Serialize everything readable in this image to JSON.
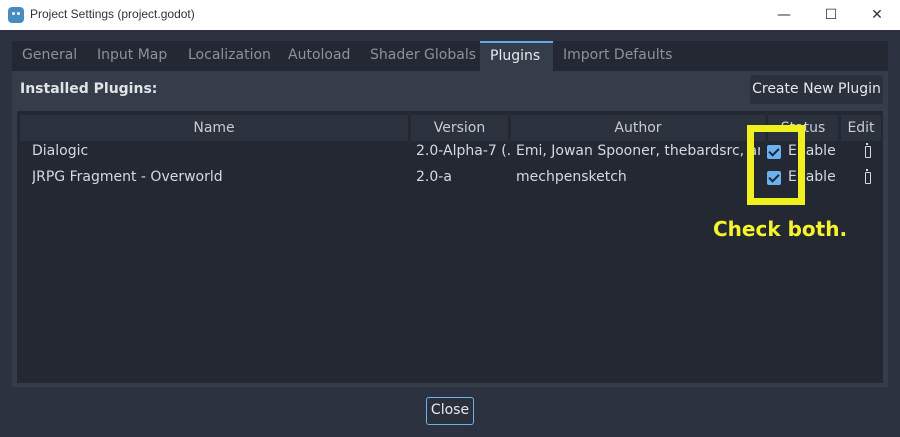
{
  "window": {
    "title": "Project Settings (project.godot)",
    "controls": {
      "minimize": "—",
      "maximize": "☐",
      "close": "✕"
    }
  },
  "tabs": [
    "General",
    "Input Map",
    "Localization",
    "Autoload",
    "Shader Globals",
    "Plugins",
    "Import Defaults"
  ],
  "active_tab": "Plugins",
  "plugins": {
    "installed_label": "Installed Plugins:",
    "create_button": "Create New Plugin",
    "columns": [
      "Name",
      "Version",
      "Author",
      "Status",
      "Edit"
    ],
    "rows": [
      {
        "name": "Dialogic",
        "version": "2.0-Alpha-7 (...",
        "author": "Emi, Jowan Spooner, thebardsrc, and",
        "status": "Enable",
        "enabled": true
      },
      {
        "name": "JRPG Fragment - Overworld",
        "version": "2.0-a",
        "author": "mechpensketch",
        "status": "Enable",
        "enabled": true
      }
    ]
  },
  "annotation": {
    "text": "Check both.",
    "color": "#f0f01e"
  },
  "footer": {
    "close_button": "Close"
  },
  "colors": {
    "accent": "#6ab1f0",
    "background": "#2c3240",
    "panel": "#363d4a",
    "table": "#232833"
  }
}
